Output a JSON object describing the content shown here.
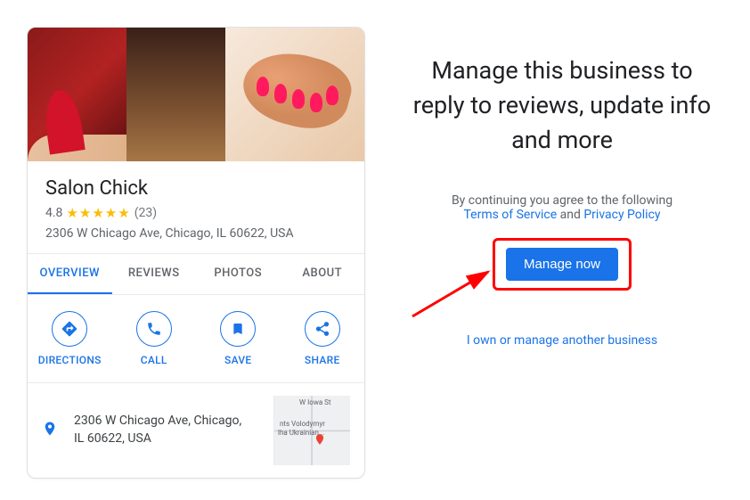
{
  "business": {
    "name": "Salon Chick",
    "rating": "4.8",
    "stars_display": "★★★★★",
    "review_count": "(23)",
    "address": "2306 W Chicago Ave, Chicago, IL 60622, USA",
    "address_multi_1": "2306 W Chicago Ave, Chicago,",
    "address_multi_2": "IL 60622, USA"
  },
  "tabs": {
    "overview": "OVERVIEW",
    "reviews": "REVIEWS",
    "photos": "PHOTOS",
    "about": "ABOUT"
  },
  "actions": {
    "directions": "DIRECTIONS",
    "call": "CALL",
    "save": "SAVE",
    "share": "SHARE"
  },
  "minimap": {
    "street1": "W Iowa St",
    "poi1": "nts Volodymyr",
    "poi2": "lha Ukrainian..."
  },
  "right": {
    "headline": "Manage this business to reply to reviews, update info and more",
    "agree_prefix": "By continuing you agree to the following",
    "tos": "Terms of Service",
    "and": " and ",
    "privacy": "Privacy Policy",
    "manage_btn": "Manage now",
    "own_another": "I own or manage another business"
  }
}
